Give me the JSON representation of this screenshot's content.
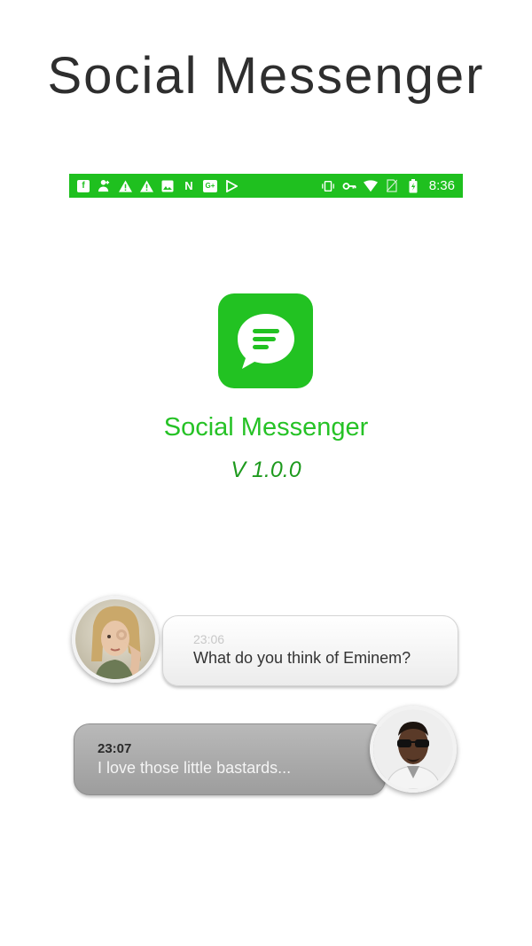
{
  "headline": "Social Messenger",
  "status_bar": {
    "time": "8:36",
    "color": "#1fc01f",
    "left_icons": [
      "facebook-icon",
      "person-add-icon",
      "warning-icon",
      "warning-icon",
      "image-icon",
      "n-app-icon",
      "google-plus-icon",
      "play-store-icon"
    ],
    "right_icons": [
      "vibrate-icon",
      "vpn-key-icon",
      "wifi-icon",
      "no-sim-icon",
      "battery-charging-icon"
    ]
  },
  "app": {
    "name": "Social Messenger",
    "version": "V 1.0.0",
    "accent": "#22c222"
  },
  "chat": {
    "incoming": {
      "time": "23:06",
      "text": "What do you think of Eminem?"
    },
    "outgoing": {
      "time": "23:07",
      "text": "I love those little bastards..."
    }
  }
}
